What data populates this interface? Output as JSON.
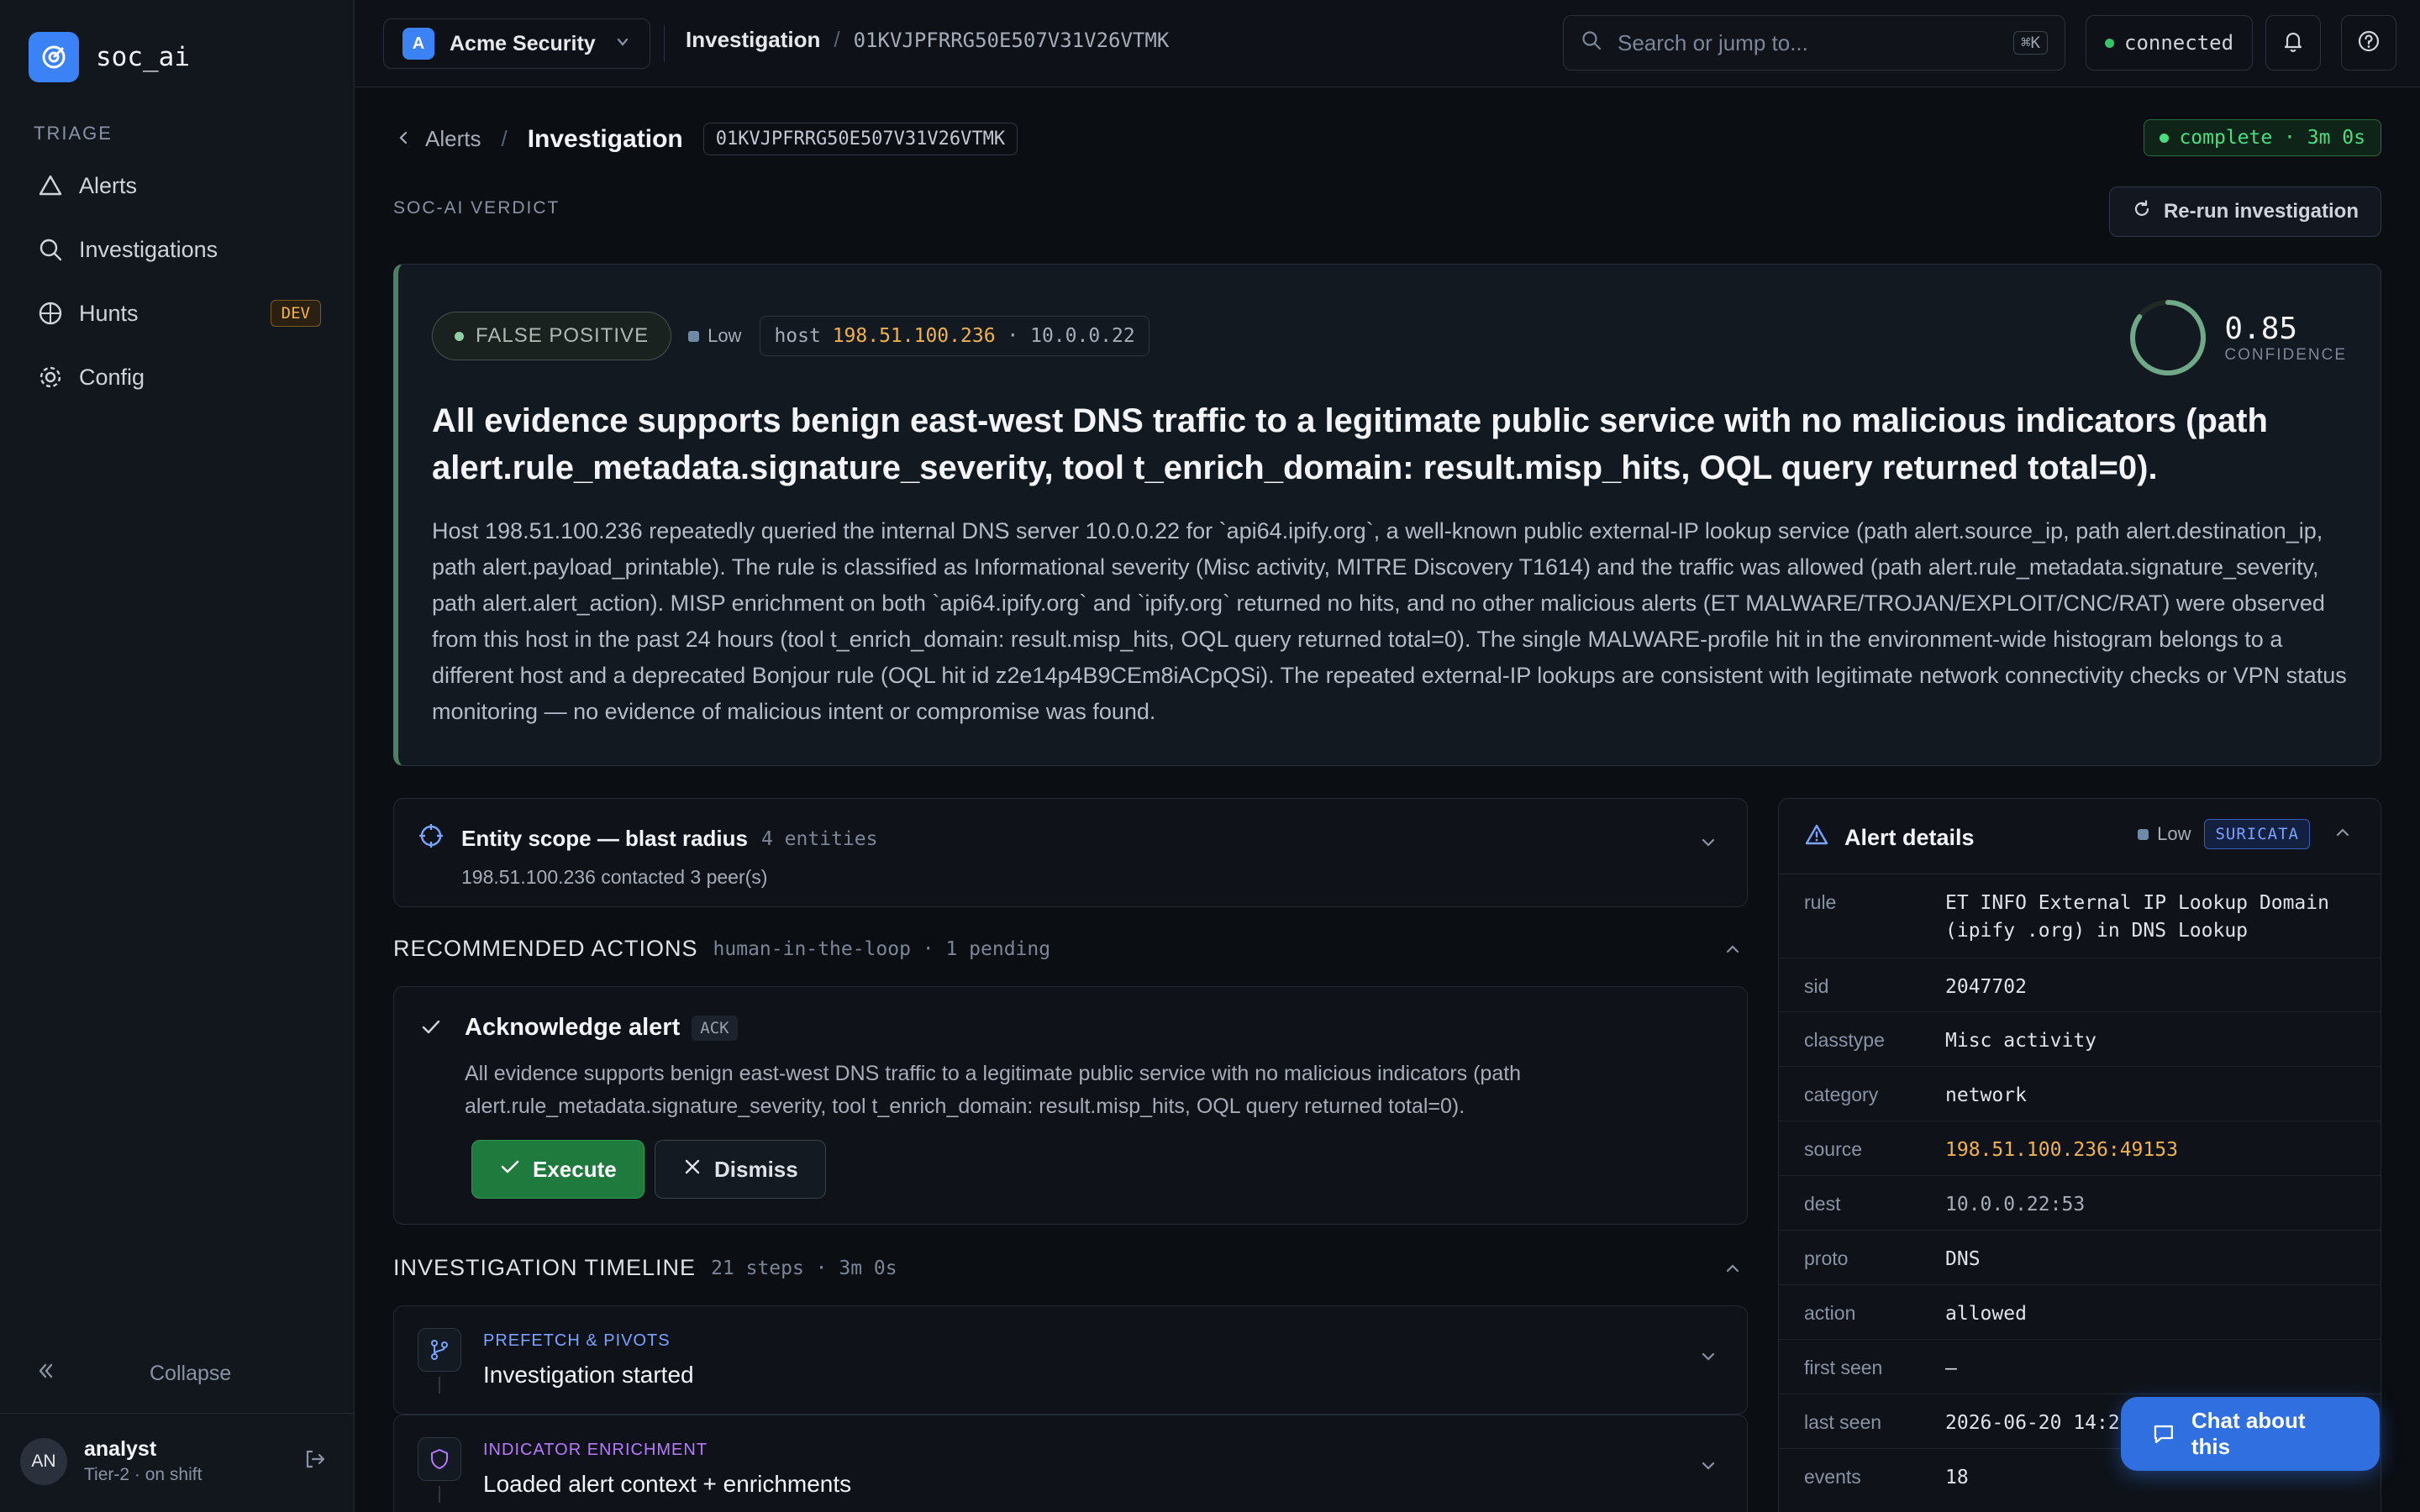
{
  "app": {
    "name": "soc_ai"
  },
  "sidebar": {
    "section": "TRIAGE",
    "items": [
      {
        "label": "Alerts",
        "icon": "triangle-alert-icon"
      },
      {
        "label": "Investigations",
        "icon": "search-icon"
      },
      {
        "label": "Hunts",
        "icon": "radar-icon",
        "badge": "DEV"
      },
      {
        "label": "Config",
        "icon": "gear-icon"
      }
    ],
    "collapse_label": "Collapse",
    "user": {
      "initials": "AN",
      "name": "analyst",
      "role": "Tier-2 · on shift"
    }
  },
  "topbar": {
    "org_initial": "A",
    "org_name": "Acme Security",
    "crumb_label": "Investigation",
    "crumb_id": "01KVJPFRRG50E507V31V26VTMK",
    "search_placeholder": "Search or jump to...",
    "search_shortcut": "⌘K",
    "status": "connected"
  },
  "page": {
    "back_label": "Alerts",
    "title": "Investigation",
    "id": "01KVJPFRRG50E507V31V26VTMK",
    "status": "complete · 3m 0s",
    "verdict_section": "SOC-AI VERDICT",
    "rerun_label": "Re-run investigation"
  },
  "verdict": {
    "label": "FALSE POSITIVE",
    "severity": "Low",
    "host_prefix": "host",
    "host_ip": "198.51.100.236",
    "host_dest": "· 10.0.0.22",
    "confidence": 0.85,
    "confidence_text": "0.85",
    "confidence_label": "CONFIDENCE",
    "headline": "All evidence supports benign east-west DNS traffic to a legitimate public service with no malicious indicators (path alert.rule_metadata.signature_severity, tool t_enrich_domain: result.misp_hits, OQL query returned total=0).",
    "body": "Host 198.51.100.236 repeatedly queried the internal DNS server 10.0.0.22 for `api64.ipify.org`, a well-known public external-IP lookup service (path alert.source_ip, path alert.destination_ip, path alert.payload_printable). The rule is classified as Informational severity (Misc activity, MITRE Discovery T1614) and the traffic was allowed (path alert.rule_metadata.signature_severity, path alert.alert_action). MISP enrichment on both `api64.ipify.org` and `ipify.org` returned no hits, and no other malicious alerts (ET MALWARE/TROJAN/EXPLOIT/CNC/RAT) were observed from this host in the past 24 hours (tool t_enrich_domain: result.misp_hits, OQL query returned total=0). The single MALWARE-profile hit in the environment-wide histogram belongs to a different host and a deprecated Bonjour rule (OQL hit id z2e14p4B9CEm8iACpQSi). The repeated external-IP lookups are consistent with legitimate network connectivity checks or VPN status monitoring — no evidence of malicious intent or compromise was found."
  },
  "entity": {
    "title": "Entity scope — blast radius",
    "count": "4 entities",
    "summary": "198.51.100.236 contacted 3 peer(s)"
  },
  "actions": {
    "title": "RECOMMENDED ACTIONS",
    "meta": "human-in-the-loop · 1 pending",
    "item": {
      "title": "Acknowledge alert",
      "tag": "ACK",
      "description": "All evidence supports benign east-west DNS traffic to a legitimate public service with no malicious indicators (path alert.rule_metadata.signature_severity, tool t_enrich_domain: result.misp_hits, OQL query returned total=0).",
      "execute_label": "Execute",
      "dismiss_label": "Dismiss"
    }
  },
  "timeline": {
    "title": "INVESTIGATION TIMELINE",
    "meta": "21 steps · 3m 0s",
    "steps": [
      {
        "category": "PREFETCH & PIVOTS",
        "title": "Investigation started",
        "color": "#7aa2ff",
        "icon": "git-branch-icon"
      },
      {
        "category": "INDICATOR ENRICHMENT",
        "title": "Loaded alert context + enrichments",
        "color": "#b57aff",
        "icon": "shield-icon"
      }
    ]
  },
  "alert_details": {
    "title": "Alert details",
    "severity": "Low",
    "source_tag": "SURICATA",
    "rows": [
      {
        "key": "rule",
        "value": "ET INFO External IP Lookup Domain (ipify .org) in DNS Lookup"
      },
      {
        "key": "sid",
        "value": "2047702"
      },
      {
        "key": "classtype",
        "value": "Misc activity"
      },
      {
        "key": "category",
        "value": "network"
      },
      {
        "key": "source",
        "value": "198.51.100.236:49153"
      },
      {
        "key": "dest",
        "value": "10.0.0.22:53"
      },
      {
        "key": "proto",
        "value": "DNS"
      },
      {
        "key": "action",
        "value": "allowed"
      },
      {
        "key": "first seen",
        "value": "—"
      },
      {
        "key": "last seen",
        "value": "2026-06-20 14:2"
      },
      {
        "key": "events",
        "value": "18"
      }
    ]
  },
  "chat_label": "Chat about this",
  "colors": {
    "accent": "#3b82f6",
    "success": "#4ade80",
    "warning": "#f0b24a"
  }
}
